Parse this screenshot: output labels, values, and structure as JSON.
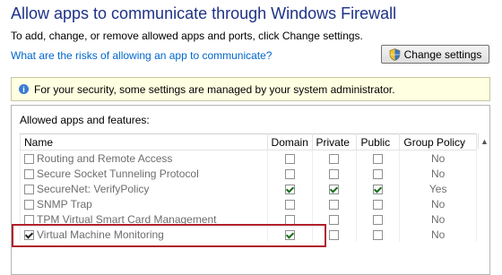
{
  "header": {
    "title": "Allow apps to communicate through Windows Firewall",
    "subtitle": "To add, change, or remove allowed apps and ports, click Change settings.",
    "risk_link": "What are the risks of allowing an app to communicate?",
    "change_button": "Change settings"
  },
  "info_bar": {
    "text": "For your security, some settings are managed by your system administrator."
  },
  "apps_panel": {
    "title": "Allowed apps and features:",
    "columns": [
      "Name",
      "Domain",
      "Private",
      "Public",
      "Group Policy"
    ],
    "rows": [
      {
        "name": "Routing and Remote Access",
        "enabled": false,
        "domain": false,
        "private": false,
        "public": false,
        "group_policy": "No"
      },
      {
        "name": "Secure Socket Tunneling Protocol",
        "enabled": false,
        "domain": false,
        "private": false,
        "public": false,
        "group_policy": "No"
      },
      {
        "name": "SecureNet: VerifyPolicy",
        "enabled": false,
        "domain": true,
        "private": true,
        "public": true,
        "group_policy": "Yes"
      },
      {
        "name": "SNMP Trap",
        "enabled": false,
        "domain": false,
        "private": false,
        "public": false,
        "group_policy": "No"
      },
      {
        "name": "TPM Virtual Smart Card Management",
        "enabled": false,
        "domain": false,
        "private": false,
        "public": false,
        "group_policy": "No"
      },
      {
        "name": "Virtual Machine Monitoring",
        "enabled": true,
        "domain": true,
        "private": false,
        "public": false,
        "group_policy": "No"
      }
    ]
  },
  "colors": {
    "title": "#1e3287",
    "link": "#0066cc",
    "info_bg": "#ffffe1",
    "highlight": "#b0202a"
  }
}
